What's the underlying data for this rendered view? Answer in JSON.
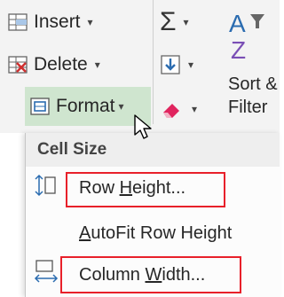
{
  "ribbon": {
    "insert_label": "Insert",
    "delete_label": "Delete",
    "format_label": "Format",
    "sort_label": "Sort &",
    "filter_label": "Filter",
    "sigma_glyph": "Σ",
    "dropdown_glyph": "▾"
  },
  "menu": {
    "section_header": "Cell Size",
    "row_height": {
      "pre": "Row ",
      "key": "H",
      "post": "eight..."
    },
    "autofit_row": {
      "pre": "",
      "key": "A",
      "post": "utoFit Row Height"
    },
    "column_width": {
      "pre": "Column ",
      "key": "W",
      "post": "idth..."
    }
  },
  "colors": {
    "highlight": "#cfe5cf",
    "redbox": "#e8202a",
    "accent_blue": "#2b6cb0",
    "eraser": "#e0245e"
  }
}
